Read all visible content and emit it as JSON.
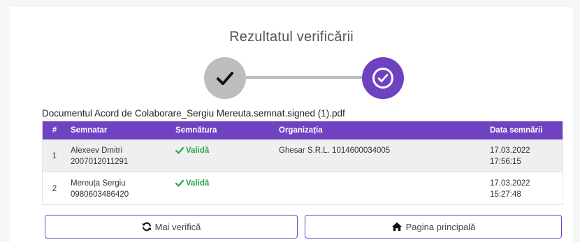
{
  "page": {
    "title": "Rezultatul verificării"
  },
  "document": {
    "name": "Documentul Acord de Colaborare_Sergiu Mereuta.semnat.signed (1).pdf"
  },
  "table": {
    "headers": [
      "#",
      "Semnatar",
      "Semnătura",
      "Organizația",
      "Data semnării"
    ],
    "rows": [
      {
        "index": "1",
        "signer_name": "Alexeev Dmitri",
        "signer_id": "2007012011291",
        "signature": "Validă",
        "organization": "Ghesar S.R.L. 1014600034005",
        "date": "17.03.2022 17:56:15"
      },
      {
        "index": "2",
        "signer_name": "Mereuța Sergiu",
        "signer_id": "0980603486420",
        "signature": "Validă",
        "organization": "",
        "date": "17.03.2022 15:27:48"
      }
    ]
  },
  "buttons": {
    "verify_again": "Mai verifică",
    "home": "Pagina principală"
  },
  "colors": {
    "accent": "#6f42c1",
    "inactive_step": "#bdbdbd",
    "valid": "#28a745"
  },
  "icons": {
    "verify_again": "refresh-icon",
    "home": "home-icon",
    "valid": "checkmark-icon"
  }
}
